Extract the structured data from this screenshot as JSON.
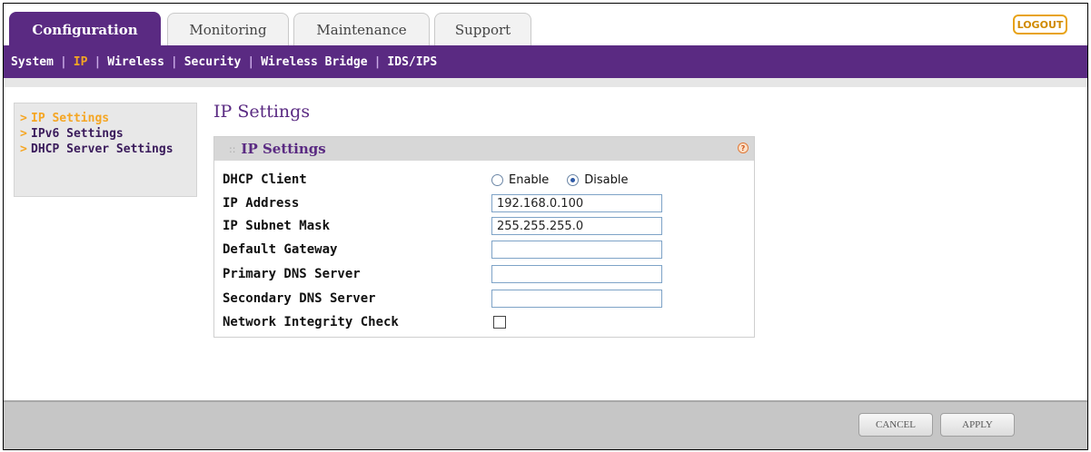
{
  "tabs": [
    {
      "label": "Configuration",
      "active": true
    },
    {
      "label": "Monitoring",
      "active": false
    },
    {
      "label": "Maintenance",
      "active": false
    },
    {
      "label": "Support",
      "active": false
    }
  ],
  "logout_label": "LOGOUT",
  "subnav": [
    {
      "label": "System",
      "active": false
    },
    {
      "label": "IP",
      "active": true
    },
    {
      "label": "Wireless",
      "active": false
    },
    {
      "label": "Security",
      "active": false
    },
    {
      "label": "Wireless Bridge",
      "active": false
    },
    {
      "label": "IDS/IPS",
      "active": false
    }
  ],
  "subnav_separator": "|",
  "sidebar": {
    "items": [
      {
        "label": "IP Settings",
        "active": true
      },
      {
        "label": "IPv6 Settings",
        "active": false
      },
      {
        "label": "DHCP Server Settings",
        "active": false
      }
    ],
    "arrow": ">"
  },
  "page_title": "IP Settings",
  "panel": {
    "title": "IP Settings",
    "help_icon": "?",
    "grip": "::"
  },
  "form": {
    "dhcp_client_label": "DHCP Client",
    "enable_label": "Enable",
    "disable_label": "Disable",
    "dhcp_selected": "Disable",
    "ip_address_label": "IP Address",
    "ip_address_value": "192.168.0.100",
    "subnet_label": "IP Subnet Mask",
    "subnet_value": "255.255.255.0",
    "gateway_label": "Default Gateway",
    "gateway_value": "",
    "primary_dns_label": "Primary DNS Server",
    "primary_dns_value": "",
    "secondary_dns_label": "Secondary DNS Server",
    "secondary_dns_value": "",
    "integrity_label": "Network Integrity Check",
    "integrity_checked": false
  },
  "buttons": {
    "cancel": "CANCEL",
    "apply": "APPLY"
  },
  "colors": {
    "brand_purple": "#5a2a82",
    "accent_orange": "#f5a623"
  }
}
